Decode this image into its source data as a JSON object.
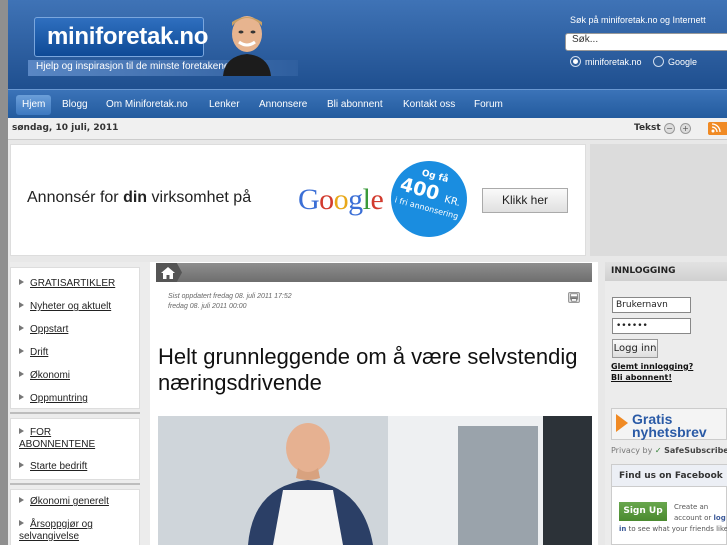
{
  "header": {
    "logo": "miniforetak.no",
    "tagline": "Hjelp og inspirasjon til de minste foretakene",
    "search_label": "Søk på miniforetak.no og Internett",
    "search_value": "Søk...",
    "radio_site": "miniforetak.no",
    "radio_google": "Google"
  },
  "nav": {
    "items": [
      "Hjem",
      "Blogg",
      "Om Miniforetak.no",
      "Lenker",
      "Annonsere",
      "Bli abonnent",
      "Kontakt oss",
      "Forum"
    ]
  },
  "datebar": {
    "date": "søndag, 10 juli, 2011",
    "text_label": "Tekst",
    "decrease": "−",
    "increase": "+"
  },
  "banner": {
    "text_pre": "Annonsér for ",
    "text_bold": "din",
    "text_post": " virksomhet på",
    "google": [
      "G",
      "o",
      "o",
      "g",
      "l",
      "e"
    ],
    "google_colors": [
      "#3b6fd6",
      "#d23b2e",
      "#e8a81a",
      "#3b6fd6",
      "#3a9a3a",
      "#d23b2e"
    ],
    "badge_l1": "Og få",
    "badge_l2": "400",
    "badge_kr": "KR.",
    "badge_l3": "i fri annonsering",
    "button": "Klikk her"
  },
  "sidebar_left": {
    "group1": [
      "GRATISARTIKLER",
      "Nyheter og aktuelt",
      "Oppstart",
      "Drift",
      "Økonomi",
      "Oppmuntring"
    ],
    "group2": [
      "FOR ABONNENTENE",
      "Starte bedrift"
    ],
    "group3": [
      "Økonomi generelt",
      "Årsoppgjør og selvangivelse"
    ]
  },
  "article": {
    "updated": "Sist oppdatert fredag 08. juli 2011 17:52",
    "published": "fredag 08. juli 2011 00:00",
    "title": "Helt grunnleggende om å være selvstendig næringsdrivende"
  },
  "sidebar_right": {
    "login_heading": "INNLOGGING",
    "username": "Brukernavn",
    "password": "••••••",
    "login_button": "Logg inn",
    "forgot": "Glemt innlogging?",
    "subscribe": "Bli abonnent!",
    "newsletter_1": "Gratis",
    "newsletter_2": "nyhetsbrev",
    "privacy": "Privacy by",
    "safesubscribe": "SafeSubscribe",
    "fb_heading": "Find us on Facebook",
    "fb_signup": "Sign Up",
    "fb_text1": "Create an",
    "fb_text2": "account or",
    "fb_login": "log",
    "fb_in": "in",
    "fb_text3": "to see what your friends like"
  },
  "colors": {
    "header_blue": "#1f4f8f",
    "nav_blue": "#235b9e",
    "badge_blue": "#1a8de0",
    "rss_orange": "#f08a24"
  }
}
